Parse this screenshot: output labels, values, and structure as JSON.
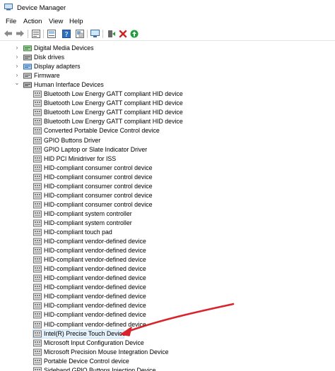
{
  "window": {
    "title": "Device Manager"
  },
  "menu": {
    "file": "File",
    "action": "Action",
    "view": "View",
    "help": "Help"
  },
  "toolbar_icons": [
    "back-arrow-icon",
    "forward-arrow-icon",
    "properties-icon",
    "update-driver-icon",
    "help-icon",
    "show-hidden-icon",
    "scan-hardware-icon",
    "add-driver-icon",
    "uninstall-icon",
    "enable-device-icon"
  ],
  "categories": [
    {
      "label": "Digital Media Devices",
      "icon": "media-device-icon"
    },
    {
      "label": "Disk drives",
      "icon": "disk-drive-icon"
    },
    {
      "label": "Display adapters",
      "icon": "display-adapter-icon"
    },
    {
      "label": "Firmware",
      "icon": "firmware-icon"
    },
    {
      "label": "Human Interface Devices",
      "icon": "hid-icon"
    }
  ],
  "hid_devices": [
    "Bluetooth Low Energy GATT compliant HID device",
    "Bluetooth Low Energy GATT compliant HID device",
    "Bluetooth Low Energy GATT compliant HID device",
    "Bluetooth Low Energy GATT compliant HID device",
    "Converted Portable Device Control device",
    "GPIO Buttons Driver",
    "GPIO Laptop or Slate Indicator Driver",
    "HID PCI Minidriver for ISS",
    "HID-compliant consumer control device",
    "HID-compliant consumer control device",
    "HID-compliant consumer control device",
    "HID-compliant consumer control device",
    "HID-compliant consumer control device",
    "HID-compliant system controller",
    "HID-compliant system controller",
    "HID-compliant touch pad",
    "HID-compliant vendor-defined device",
    "HID-compliant vendor-defined device",
    "HID-compliant vendor-defined device",
    "HID-compliant vendor-defined device",
    "HID-compliant vendor-defined device",
    "HID-compliant vendor-defined device",
    "HID-compliant vendor-defined device",
    "HID-compliant vendor-defined device",
    "HID-compliant vendor-defined device",
    "HID-compliant vendor-defined device",
    "Intel(R) Precise Touch Device",
    "Microsoft Input Configuration Device",
    "Microsoft Precision Mouse Integration Device",
    "Portable Device Control device",
    "Sideband GPIO Buttons Injection Device"
  ],
  "highlighted_device": "Intel(R) Precise Touch Device",
  "colors": {
    "arrow": "#d9232d",
    "selection": "#e5f1fb",
    "accent_green": "#1e9e3a",
    "accent_red": "#d02020"
  }
}
